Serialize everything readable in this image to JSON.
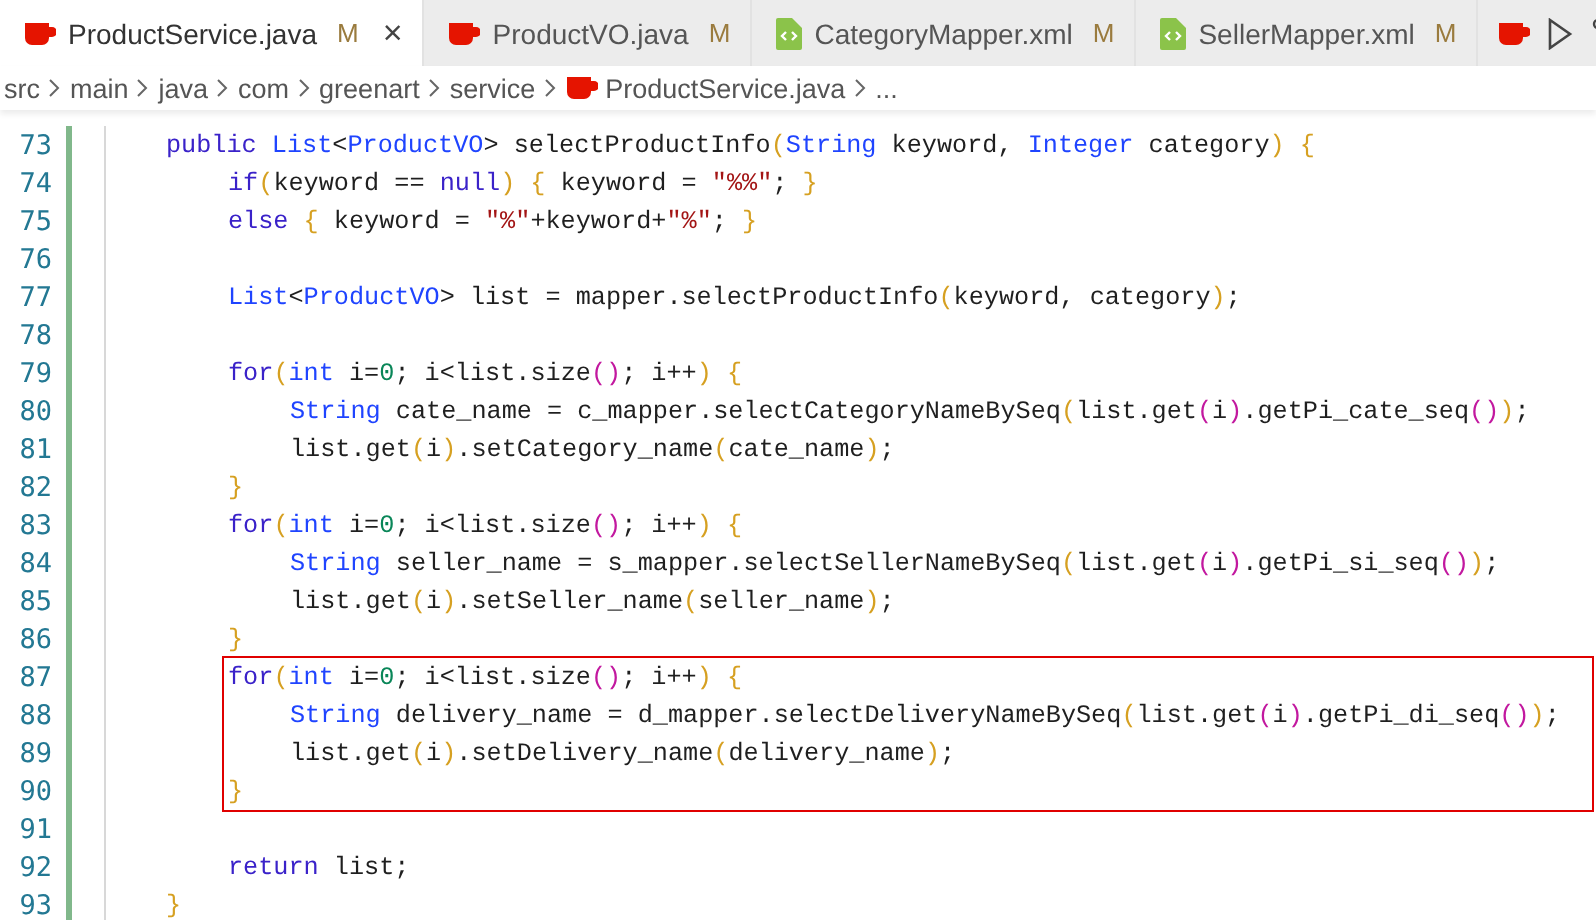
{
  "tabs": [
    {
      "label": "ProductService.java",
      "kind": "java",
      "badge": "M",
      "selected": true,
      "close": "×"
    },
    {
      "label": "ProductVO.java",
      "kind": "java",
      "badge": "M",
      "selected": false
    },
    {
      "label": "CategoryMapper.xml",
      "kind": "xml",
      "badge": "M",
      "selected": false
    },
    {
      "label": "SellerMapper.xml",
      "kind": "xml",
      "badge": "M",
      "selected": false
    }
  ],
  "breadcrumb": {
    "parts": [
      "src",
      "main",
      "java",
      "com",
      "greenart",
      "service"
    ],
    "file": "ProductService.java",
    "more": "..."
  },
  "lines": [
    {
      "number": "73",
      "tokens": [
        {
          "text": "public ",
          "kind": "kw"
        },
        {
          "text": "List",
          "kind": "type"
        },
        {
          "text": "<",
          "kind": "p"
        },
        {
          "text": "ProductVO",
          "kind": "type"
        },
        {
          "text": "> selectProductInfo",
          "kind": "p"
        },
        {
          "text": "(",
          "kind": "b1"
        },
        {
          "text": "String",
          "kind": "type"
        },
        {
          "text": " keyword, ",
          "kind": "p"
        },
        {
          "text": "Integer",
          "kind": "type"
        },
        {
          "text": " category",
          "kind": "p"
        },
        {
          "text": ") {",
          "kind": "b1"
        }
      ],
      "children": [
        {
          "number": "74",
          "tokens": [
            {
              "text": "if",
              "kind": "kw"
            },
            {
              "text": "(",
              "kind": "b1"
            },
            {
              "text": "keyword == ",
              "kind": "p"
            },
            {
              "text": "null",
              "kind": "kw"
            },
            {
              "text": ") {",
              "kind": "b1"
            },
            {
              "text": " keyword = ",
              "kind": "p"
            },
            {
              "text": "\"%%\"",
              "kind": "str"
            },
            {
              "text": "; ",
              "kind": "p"
            },
            {
              "text": "}",
              "kind": "b1"
            }
          ]
        },
        {
          "number": "75",
          "tokens": [
            {
              "text": "else ",
              "kind": "kw"
            },
            {
              "text": "{",
              "kind": "b1"
            },
            {
              "text": " keyword = ",
              "kind": "p"
            },
            {
              "text": "\"%\"",
              "kind": "str"
            },
            {
              "text": "+keyword+",
              "kind": "p"
            },
            {
              "text": "\"%\"",
              "kind": "str"
            },
            {
              "text": "; ",
              "kind": "p"
            },
            {
              "text": "}",
              "kind": "b1"
            }
          ]
        },
        {
          "number": "76"
        },
        {
          "number": "77",
          "tokens": [
            {
              "text": "List",
              "kind": "type"
            },
            {
              "text": "<",
              "kind": "p"
            },
            {
              "text": "ProductVO",
              "kind": "type"
            },
            {
              "text": "> list = mapper.selectProductInfo",
              "kind": "p"
            },
            {
              "text": "(",
              "kind": "b1"
            },
            {
              "text": "keyword, category",
              "kind": "p"
            },
            {
              "text": ")",
              "kind": "b1"
            },
            {
              "text": ";",
              "kind": "p"
            }
          ]
        },
        {
          "number": "78"
        },
        {
          "number": "79",
          "tokens": [
            {
              "text": "for",
              "kind": "kw"
            },
            {
              "text": "(",
              "kind": "b1"
            },
            {
              "text": "int",
              "kind": "type"
            },
            {
              "text": " i=",
              "kind": "p"
            },
            {
              "text": "0",
              "kind": "num"
            },
            {
              "text": "; i<list.size",
              "kind": "p"
            },
            {
              "text": "()",
              "kind": "b2"
            },
            {
              "text": "; i++",
              "kind": "p"
            },
            {
              "text": ") {",
              "kind": "b1"
            }
          ],
          "children": [
            {
              "number": "80",
              "tokens": [
                {
                  "text": "String",
                  "kind": "type"
                },
                {
                  "text": " cate_name = c_mapper.selectCategoryNameBySeq",
                  "kind": "p"
                },
                {
                  "text": "(",
                  "kind": "b1"
                },
                {
                  "text": "list.get",
                  "kind": "p"
                },
                {
                  "text": "(",
                  "kind": "b2"
                },
                {
                  "text": "i",
                  "kind": "p"
                },
                {
                  "text": ")",
                  "kind": "b2"
                },
                {
                  "text": ".getPi_cate_seq",
                  "kind": "p"
                },
                {
                  "text": "()",
                  "kind": "b2"
                },
                {
                  "text": ")",
                  "kind": "b1"
                },
                {
                  "text": ";",
                  "kind": "p"
                }
              ]
            },
            {
              "number": "81",
              "tokens": [
                {
                  "text": "list.get",
                  "kind": "p"
                },
                {
                  "text": "(",
                  "kind": "b1"
                },
                {
                  "text": "i",
                  "kind": "p"
                },
                {
                  "text": ")",
                  "kind": "b1"
                },
                {
                  "text": ".setCategory_name",
                  "kind": "p"
                },
                {
                  "text": "(",
                  "kind": "b1"
                },
                {
                  "text": "cate_name",
                  "kind": "p"
                },
                {
                  "text": ")",
                  "kind": "b1"
                },
                {
                  "text": ";",
                  "kind": "p"
                }
              ]
            }
          ]
        },
        {
          "number": "82",
          "tokens": [
            {
              "text": "}",
              "kind": "b1"
            }
          ]
        },
        {
          "number": "83",
          "tokens": [
            {
              "text": "for",
              "kind": "kw"
            },
            {
              "text": "(",
              "kind": "b1"
            },
            {
              "text": "int",
              "kind": "type"
            },
            {
              "text": " i=",
              "kind": "p"
            },
            {
              "text": "0",
              "kind": "num"
            },
            {
              "text": "; i<list.size",
              "kind": "p"
            },
            {
              "text": "()",
              "kind": "b2"
            },
            {
              "text": "; i++",
              "kind": "p"
            },
            {
              "text": ") {",
              "kind": "b1"
            }
          ],
          "children": [
            {
              "number": "84",
              "tokens": [
                {
                  "text": "String",
                  "kind": "type"
                },
                {
                  "text": " seller_name = s_mapper.selectSellerNameBySeq",
                  "kind": "p"
                },
                {
                  "text": "(",
                  "kind": "b1"
                },
                {
                  "text": "list.get",
                  "kind": "p"
                },
                {
                  "text": "(",
                  "kind": "b2"
                },
                {
                  "text": "i",
                  "kind": "p"
                },
                {
                  "text": ")",
                  "kind": "b2"
                },
                {
                  "text": ".getPi_si_seq",
                  "kind": "p"
                },
                {
                  "text": "()",
                  "kind": "b2"
                },
                {
                  "text": ")",
                  "kind": "b1"
                },
                {
                  "text": ";",
                  "kind": "p"
                }
              ]
            },
            {
              "number": "85",
              "tokens": [
                {
                  "text": "list.get",
                  "kind": "p"
                },
                {
                  "text": "(",
                  "kind": "b1"
                },
                {
                  "text": "i",
                  "kind": "p"
                },
                {
                  "text": ")",
                  "kind": "b1"
                },
                {
                  "text": ".setSeller_name",
                  "kind": "p"
                },
                {
                  "text": "(",
                  "kind": "b1"
                },
                {
                  "text": "seller_name",
                  "kind": "p"
                },
                {
                  "text": ")",
                  "kind": "b1"
                },
                {
                  "text": ";",
                  "kind": "p"
                }
              ]
            }
          ]
        },
        {
          "number": "86",
          "tokens": [
            {
              "text": "}",
              "kind": "b1"
            }
          ]
        },
        {
          "number": "87",
          "boxed": true,
          "tokens": [
            {
              "text": "for",
              "kind": "kw"
            },
            {
              "text": "(",
              "kind": "b1"
            },
            {
              "text": "int",
              "kind": "type"
            },
            {
              "text": " i=",
              "kind": "p"
            },
            {
              "text": "0",
              "kind": "num"
            },
            {
              "text": "; i<list.size",
              "kind": "p"
            },
            {
              "text": "()",
              "kind": "b2"
            },
            {
              "text": "; i++",
              "kind": "p"
            },
            {
              "text": ") {",
              "kind": "b1"
            }
          ],
          "children": [
            {
              "number": "88",
              "boxed": true,
              "tokens": [
                {
                  "text": "String",
                  "kind": "type"
                },
                {
                  "text": " delivery_name = d_mapper.selectDeliveryNameBySeq",
                  "kind": "p"
                },
                {
                  "text": "(",
                  "kind": "b1"
                },
                {
                  "text": "list.get",
                  "kind": "p"
                },
                {
                  "text": "(",
                  "kind": "b2"
                },
                {
                  "text": "i",
                  "kind": "p"
                },
                {
                  "text": ")",
                  "kind": "b2"
                },
                {
                  "text": ".getPi_di_seq",
                  "kind": "p"
                },
                {
                  "text": "()",
                  "kind": "b2"
                },
                {
                  "text": ")",
                  "kind": "b1"
                },
                {
                  "text": ";",
                  "kind": "p"
                }
              ]
            },
            {
              "number": "89",
              "boxed": true,
              "tokens": [
                {
                  "text": "list.get",
                  "kind": "p"
                },
                {
                  "text": "(",
                  "kind": "b1"
                },
                {
                  "text": "i",
                  "kind": "p"
                },
                {
                  "text": ")",
                  "kind": "b1"
                },
                {
                  "text": ".setDelivery_name",
                  "kind": "p"
                },
                {
                  "text": "(",
                  "kind": "b1"
                },
                {
                  "text": "delivery_name",
                  "kind": "p"
                },
                {
                  "text": ")",
                  "kind": "b1"
                },
                {
                  "text": ";",
                  "kind": "p"
                }
              ]
            }
          ]
        },
        {
          "number": "90",
          "boxed": true,
          "tokens": [
            {
              "text": "}",
              "kind": "b1"
            }
          ]
        },
        {
          "number": "91"
        },
        {
          "number": "92",
          "tokens": [
            {
              "text": "return",
              "kind": "kw"
            },
            {
              "text": " list;",
              "kind": "p"
            }
          ]
        }
      ]
    },
    {
      "number": "93",
      "tokens": [
        {
          "text": "}",
          "kind": "b1"
        }
      ]
    }
  ]
}
